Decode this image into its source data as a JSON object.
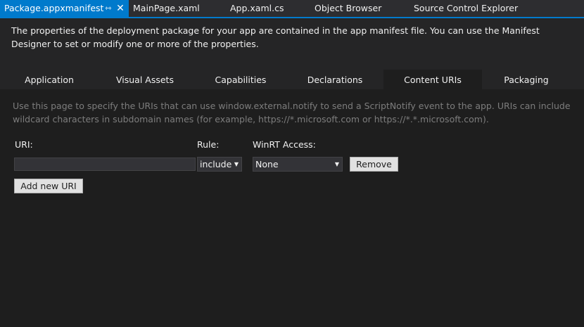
{
  "doc_tabs": [
    {
      "label": "Package.appxmanifest",
      "active": true
    },
    {
      "label": "MainPage.xaml",
      "active": false
    },
    {
      "label": "App.xaml.cs",
      "active": false
    },
    {
      "label": "Object Browser",
      "active": false
    },
    {
      "label": "Source Control Explorer",
      "active": false
    }
  ],
  "tab_icons": {
    "pin": "pin-icon",
    "close": "close-icon"
  },
  "header_description": "The properties of the deployment package for your app are contained in the app manifest file. You can use the Manifest Designer to set or modify one or more of the properties.",
  "designer_tabs": [
    {
      "label": "Application",
      "active": false
    },
    {
      "label": "Visual Assets",
      "active": false
    },
    {
      "label": "Capabilities",
      "active": false
    },
    {
      "label": "Declarations",
      "active": false
    },
    {
      "label": "Content URIs",
      "active": true
    },
    {
      "label": "Packaging",
      "active": false
    }
  ],
  "content_uris": {
    "description": "Use this page to specify the URIs that can use window.external.notify to send a ScriptNotify event to the app. URIs can include wildcard characters in subdomain names (for example, https://*.microsoft.com or https://*.*.microsoft.com).",
    "uri_label": "URI:",
    "rule_label": "Rule:",
    "winrt_label": "WinRT Access:",
    "uri_value": "",
    "rule_value": "include",
    "winrt_value": "None",
    "remove_label": "Remove",
    "add_label": "Add new URI"
  },
  "colors": {
    "accent": "#007acc",
    "background": "#252526",
    "panel": "#1e1e1e",
    "muted_text": "#7d7d7d"
  }
}
